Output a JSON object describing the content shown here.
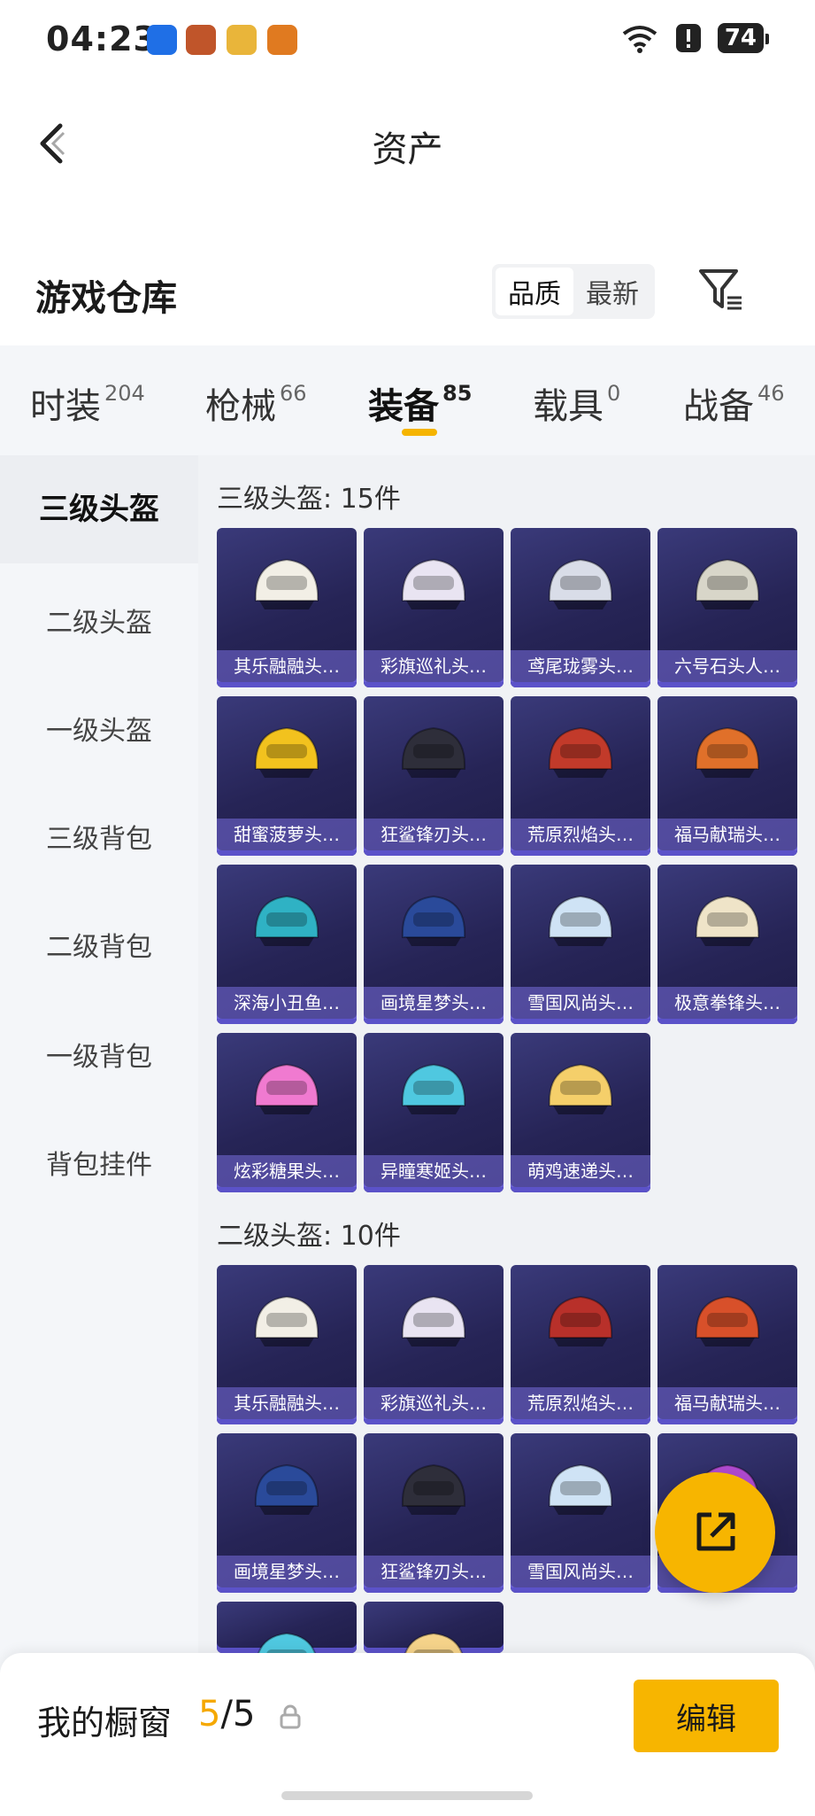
{
  "status_bar": {
    "time": "04:23",
    "battery": "74"
  },
  "header": {
    "title": "资产"
  },
  "warehouse": {
    "title": "游戏仓库",
    "sort_options": [
      "品质",
      "最新"
    ],
    "sort_selected": "品质"
  },
  "tabs": [
    {
      "label": "时装",
      "count": "204"
    },
    {
      "label": "枪械",
      "count": "66"
    },
    {
      "label": "装备",
      "count": "85",
      "active": true
    },
    {
      "label": "载具",
      "count": "0"
    },
    {
      "label": "战备",
      "count": "46"
    }
  ],
  "sidebar": {
    "items": [
      "三级头盔",
      "二级头盔",
      "一级头盔",
      "三级背包",
      "二级背包",
      "一级背包",
      "背包挂件"
    ],
    "active": "三级头盔"
  },
  "sections": [
    {
      "title": "三级头盔: 15件",
      "items": [
        {
          "name": "其乐融融头…",
          "color": "#f2efe6"
        },
        {
          "name": "彩旗巡礼头…",
          "color": "#e9e4f2"
        },
        {
          "name": "鸢尾珑雾头…",
          "color": "#d9dde8"
        },
        {
          "name": "六号石头人…",
          "color": "#d8d6c9"
        },
        {
          "name": "甜蜜菠萝头…",
          "color": "#f2c21e"
        },
        {
          "name": "狂鲨锋刃头…",
          "color": "#2e2e3a"
        },
        {
          "name": "荒原烈焰头…",
          "color": "#c23a2a"
        },
        {
          "name": "福马献瑞头…",
          "color": "#e0702a"
        },
        {
          "name": "深海小丑鱼…",
          "color": "#2fb2c4"
        },
        {
          "name": "画境星梦头…",
          "color": "#2a4a9a"
        },
        {
          "name": "雪国风尚头…",
          "color": "#cfe3f5"
        },
        {
          "name": "极意拳锋头…",
          "color": "#efe4c8"
        },
        {
          "name": "炫彩糖果头…",
          "color": "#f07ad0"
        },
        {
          "name": "异瞳寒姬头…",
          "color": "#4fc8e0"
        },
        {
          "name": "萌鸡速递头…",
          "color": "#f5cf6a"
        }
      ]
    },
    {
      "title": "二级头盔: 10件",
      "items": [
        {
          "name": "其乐融融头…",
          "color": "#f2efe6"
        },
        {
          "name": "彩旗巡礼头…",
          "color": "#e9e4f2"
        },
        {
          "name": "荒原烈焰头…",
          "color": "#b8302a"
        },
        {
          "name": "福马献瑞头…",
          "color": "#d8502a"
        },
        {
          "name": "画境星梦头…",
          "color": "#2a4a9a"
        },
        {
          "name": "狂鲨锋刃头…",
          "color": "#2e2e3a"
        },
        {
          "name": "雪国风尚头…",
          "color": "#cfe3f5"
        },
        {
          "name": "",
          "color": "#b04ad0"
        },
        {
          "name": "",
          "color": "#4fc8e0"
        },
        {
          "name": "",
          "color": "#f5d38a"
        }
      ]
    }
  ],
  "showcase": {
    "label": "我的橱窗",
    "current": "5",
    "total": "5",
    "edit_label": "编辑"
  },
  "colors": {
    "accent": "#f7b500",
    "card_bg": "#262456"
  }
}
